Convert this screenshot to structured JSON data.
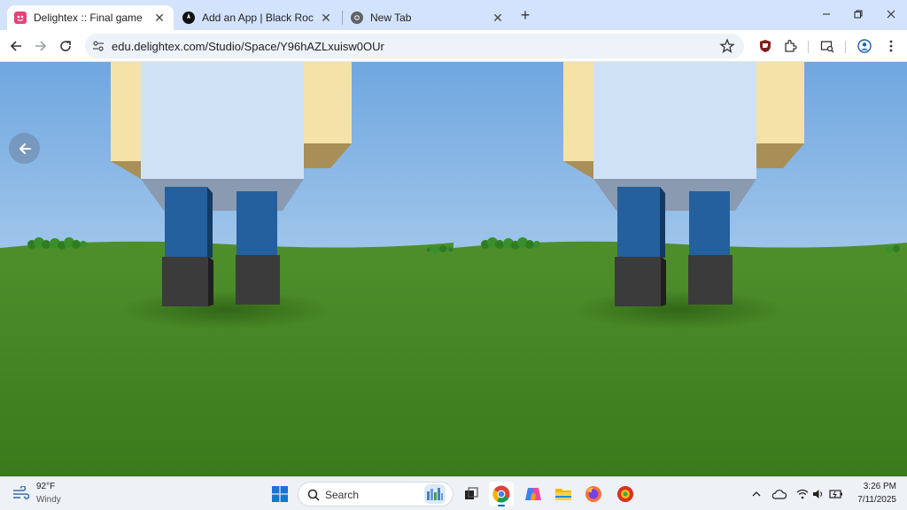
{
  "browser": {
    "tabs": [
      {
        "title": "Delightex :: Final game",
        "active": true,
        "favicon": "delightex-icon"
      },
      {
        "title": "Add an App | Black Rocket Arca",
        "active": false,
        "favicon": "black-rocket-icon"
      },
      {
        "title": "New Tab",
        "active": false,
        "favicon": "chrome-icon"
      }
    ],
    "new_tab_icon": "plus-icon",
    "window_controls": [
      "minimize-icon",
      "restore-icon",
      "close-icon"
    ],
    "url": "edu.delightex.com/Studio/Space/Y96hAZLxuisw0OUr",
    "extension_badge": "4"
  },
  "scene": {
    "back_button_icon": "arrow-left-icon",
    "colors": {
      "sky_top": "#6fa7e0",
      "sky_horizon": "#dce9f4",
      "grass": "#3f7d20",
      "grass_dark": "#2f6a16",
      "character_body": "#cfe2f5",
      "character_arm": "#f5e2a8",
      "character_leg": "#23609d",
      "character_boot": "#3b3b3b"
    }
  },
  "taskbar": {
    "weather": {
      "temp": "92°F",
      "desc": "Windy"
    },
    "search_placeholder": "Search",
    "apps": [
      "windows-start-icon",
      "search-icon",
      "task-view-icon",
      "chrome-icon",
      "copilot-icon",
      "file-explorer-icon",
      "firefox-icon",
      "app-icon"
    ],
    "clock": {
      "time": "3:26 PM",
      "date": "7/11/2025"
    }
  }
}
